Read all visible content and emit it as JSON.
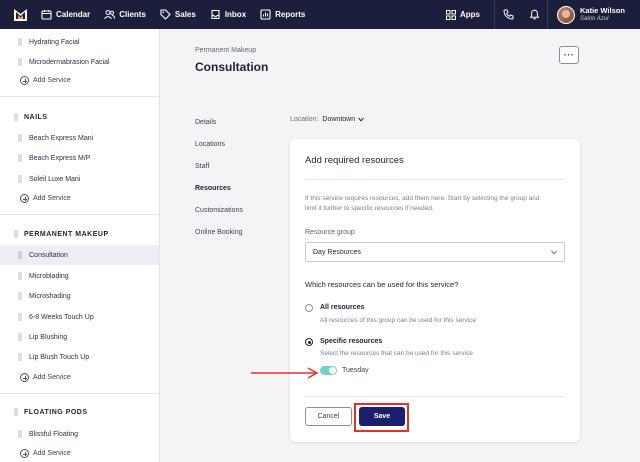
{
  "topbar": {
    "nav": [
      {
        "label": "Calendar",
        "icon": "calendar-icon"
      },
      {
        "label": "Clients",
        "icon": "clients-icon"
      },
      {
        "label": "Sales",
        "icon": "sales-tag-icon"
      },
      {
        "label": "Inbox",
        "icon": "inbox-icon"
      },
      {
        "label": "Reports",
        "icon": "reports-icon"
      }
    ],
    "apps_label": "Apps",
    "user_name": "Katie Wilson",
    "salon_name": "Salon Azul"
  },
  "sidebar": {
    "services_top": [
      "Hydrating Facial",
      "Microdermabrasion Facial"
    ],
    "add_service": "Add Service",
    "nails": {
      "title": "NAILS",
      "items": [
        "Beach Express Mani",
        "Beach Express M/P",
        "Soleil Luxe Mani"
      ]
    },
    "permanent_makeup": {
      "title": "PERMANENT MAKEUP",
      "items": [
        "Consultation",
        "Microblading",
        "Microshading",
        "6-8 Weeks Touch Up",
        "Lip Blushing",
        "Lip Blush Touch Up"
      ]
    },
    "floating_pods": {
      "title": "FLOATING PODS",
      "items": [
        "Blissful Floating"
      ]
    }
  },
  "main": {
    "breadcrumb": "Permanent Makeup",
    "title": "Consultation",
    "more_label": "···",
    "subnav": [
      "Details",
      "Locations",
      "Staff",
      "Resources",
      "Customizations",
      "Online Booking"
    ],
    "subnav_active": "Resources",
    "location_label": "Location:",
    "location_value": "Downtown"
  },
  "card": {
    "title": "Add required resources",
    "help": "If this service requires resources, add them here. Start by selecting the group and limit it further to specific resources if needed.",
    "group_label": "Resource group",
    "group_value": "Day Resources",
    "question": "Which resources can be used for this service?",
    "option_all_title": "All resources",
    "option_all_desc": "All resources of this group can be used for this service",
    "option_specific_title": "Specific resources",
    "option_specific_desc": "Select the resources that can be used for this service",
    "selected_option": "specific",
    "toggle_label": "Tuesday",
    "toggle_on": true,
    "cancel_label": "Cancel",
    "save_label": "Save"
  },
  "colors": {
    "topbar": "#1b1f3b",
    "save_button": "#1b1f6b",
    "toggle_on": "#6fd0cc",
    "annotation": "#e0322a"
  }
}
